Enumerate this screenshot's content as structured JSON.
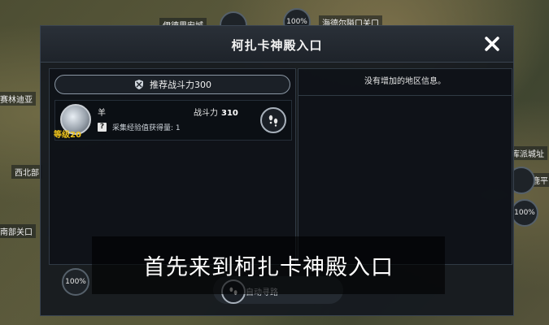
{
  "map": {
    "labels": [
      "赛林迪亚",
      "西北部",
      "南部关口",
      "海德尔隘口关口",
      "伊德里安城",
      "库派城址",
      "鹿平"
    ],
    "percent_badge": "100%"
  },
  "dialog": {
    "title": "柯扎卡神殿入口",
    "close_icon": "close-icon",
    "recommended_power": "推荐战斗力300",
    "monster": {
      "name": "羊",
      "level": "等级20",
      "power_label": "战斗力",
      "power_value": "310",
      "exp_text": "采集经验值获得量: 1",
      "exp_icon": "?"
    },
    "right_panel_text": "没有增加的地区信息。"
  },
  "bottom": {
    "auto_path_label": "自动寻路",
    "percent": "100%"
  },
  "subtitle": "首先来到柯扎卡神殿入口"
}
